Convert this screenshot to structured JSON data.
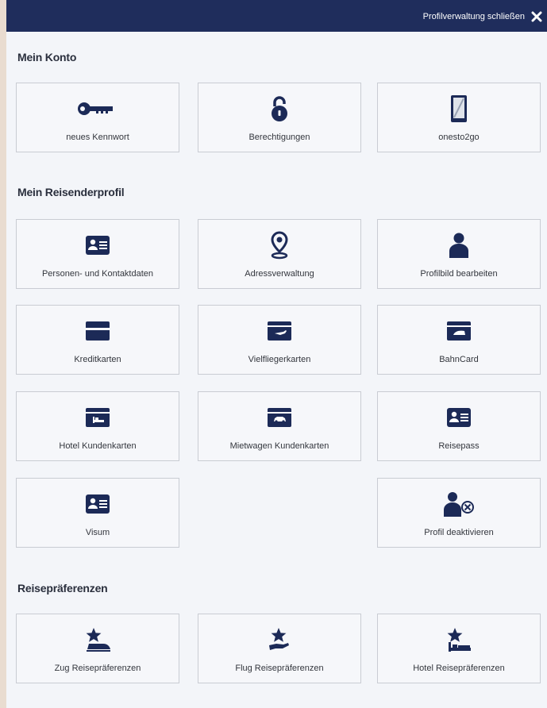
{
  "header": {
    "close_label": "Profilverwaltung schließen",
    "close_icon": "close-x-icon"
  },
  "colors": {
    "brand": "#1f2d5c",
    "icon": "#1c2a57",
    "tile_border": "#c9ccd3",
    "background": "#f3f5f9"
  },
  "sections": {
    "konto": {
      "title": "Mein Konto",
      "tiles": [
        {
          "label": "neues Kennwort",
          "icon": "key-icon"
        },
        {
          "label": "Berechtigungen",
          "icon": "padlock-icon"
        },
        {
          "label": "onesto2go",
          "icon": "smartphone-icon"
        }
      ]
    },
    "profil": {
      "title": "Mein Reisenderprofil",
      "tiles": [
        {
          "label": "Personen- und Kontaktdaten",
          "icon": "id-card-icon"
        },
        {
          "label": "Adressverwaltung",
          "icon": "map-pin-icon"
        },
        {
          "label": "Profilbild bearbeiten",
          "icon": "user-icon"
        },
        {
          "label": "Kreditkarten",
          "icon": "credit-card-icon"
        },
        {
          "label": "Vielfliegerkarten",
          "icon": "frequent-flyer-card-icon"
        },
        {
          "label": "BahnCard",
          "icon": "bahncard-icon"
        },
        {
          "label": "Hotel Kundenkarten",
          "icon": "hotel-card-icon"
        },
        {
          "label": "Mietwagen Kundenkarten",
          "icon": "rental-car-card-icon"
        },
        {
          "label": "Reisepass",
          "icon": "passport-id-icon"
        },
        {
          "label": "Visum",
          "icon": "visa-id-icon"
        },
        {
          "label": "Profil deaktivieren",
          "icon": "user-deactivate-icon"
        }
      ]
    },
    "praeferenzen": {
      "title": "Reisepräferenzen",
      "tiles": [
        {
          "label": "Zug Reisepräferenzen",
          "icon": "star-train-icon"
        },
        {
          "label": "Flug Reisepräferenzen",
          "icon": "star-hand-icon"
        },
        {
          "label": "Hotel Reisepräferenzen",
          "icon": "star-bed-icon"
        }
      ]
    }
  }
}
